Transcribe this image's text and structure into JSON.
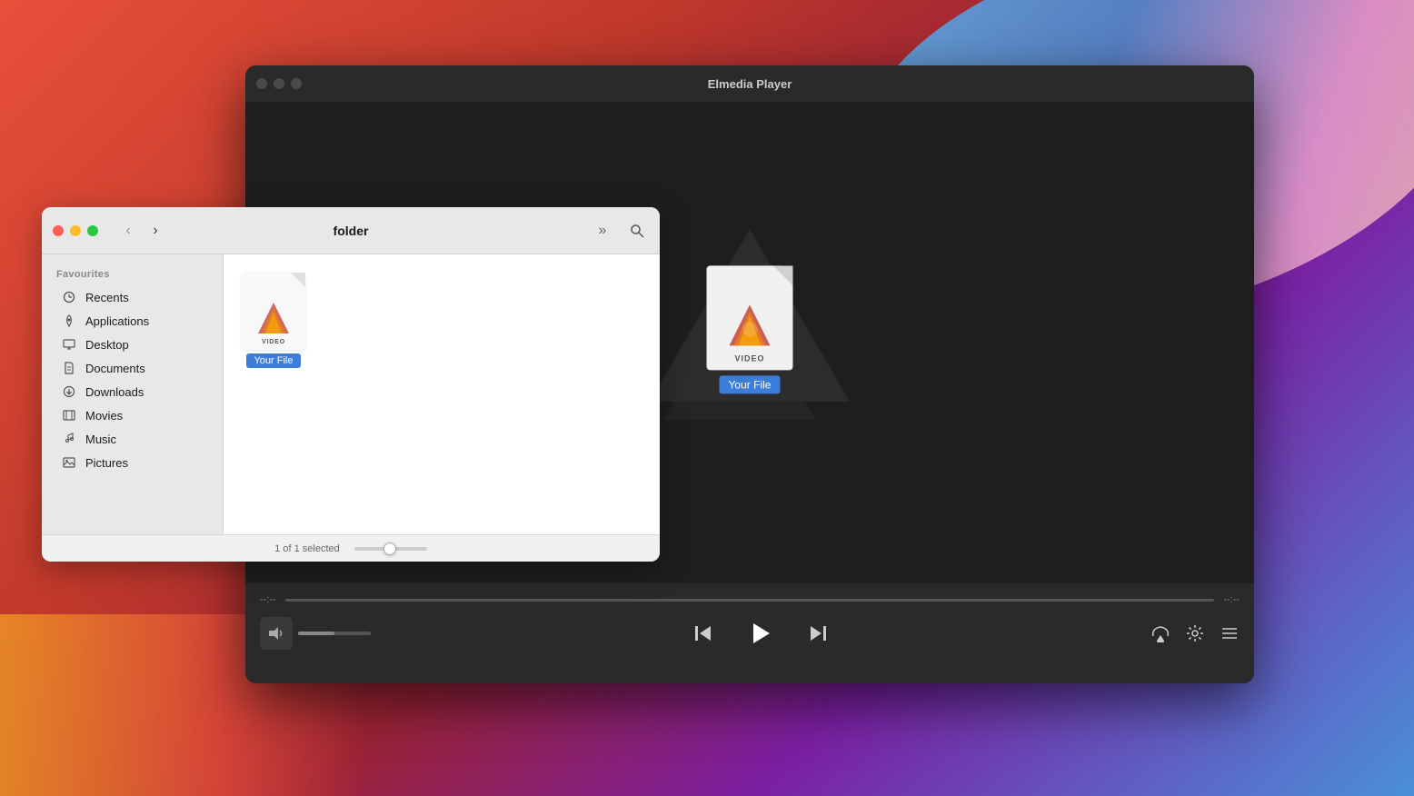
{
  "desktop": {
    "bg_color": "#c0392b"
  },
  "player": {
    "title": "Elmedia Player",
    "traffic_lights": {
      "close": "close",
      "minimize": "minimize",
      "maximize": "maximize"
    },
    "file_icon": {
      "label": "VIDEO",
      "name": "Your File"
    },
    "controls": {
      "time_start": "--:--",
      "time_end": "--:--",
      "volume_icon": "🔈",
      "prev_label": "⏮",
      "play_label": "▶",
      "next_label": "⏭",
      "airplay_label": "airplay",
      "settings_label": "settings",
      "playlist_label": "playlist"
    }
  },
  "finder": {
    "title": "folder",
    "traffic_lights": {
      "close": "close",
      "minimize": "minimize",
      "maximize": "maximize"
    },
    "nav": {
      "back_label": "‹",
      "forward_label": "›",
      "breadcrumb_label": "»",
      "search_label": "search"
    },
    "sidebar": {
      "section_label": "Favourites",
      "items": [
        {
          "id": "recents",
          "label": "Recents",
          "icon": "clock"
        },
        {
          "id": "applications",
          "label": "Applications",
          "icon": "rocket"
        },
        {
          "id": "desktop",
          "label": "Desktop",
          "icon": "monitor"
        },
        {
          "id": "documents",
          "label": "Documents",
          "icon": "file"
        },
        {
          "id": "downloads",
          "label": "Downloads",
          "icon": "download"
        },
        {
          "id": "movies",
          "label": "Movies",
          "icon": "film"
        },
        {
          "id": "music",
          "label": "Music",
          "icon": "music"
        },
        {
          "id": "pictures",
          "label": "Pictures",
          "icon": "image"
        }
      ]
    },
    "content": {
      "file": {
        "label": "VIDEO",
        "name": "Your File"
      }
    },
    "statusbar": {
      "selection_text": "1 of 1 selected"
    }
  }
}
